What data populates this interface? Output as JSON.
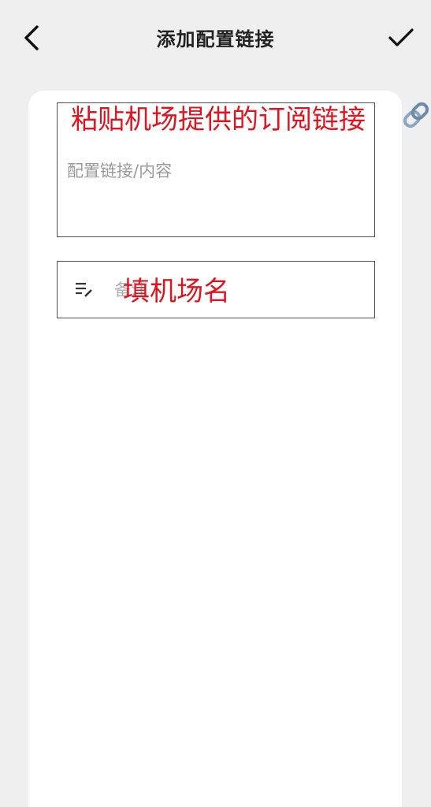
{
  "header": {
    "title": "添加配置链接"
  },
  "form": {
    "link_placeholder": "配置链接/内容",
    "name_placeholder": "备注"
  },
  "annotations": {
    "link_hint": "粘贴机场提供的订阅链接",
    "name_hint": "填机场名"
  },
  "colors": {
    "background": "#efefef",
    "card": "#ffffff",
    "annotation": "#e0141e",
    "border": "#4a4f52"
  },
  "icons": [
    "back-arrow-icon",
    "check-icon",
    "notes-edit-icon",
    "link-icon"
  ]
}
